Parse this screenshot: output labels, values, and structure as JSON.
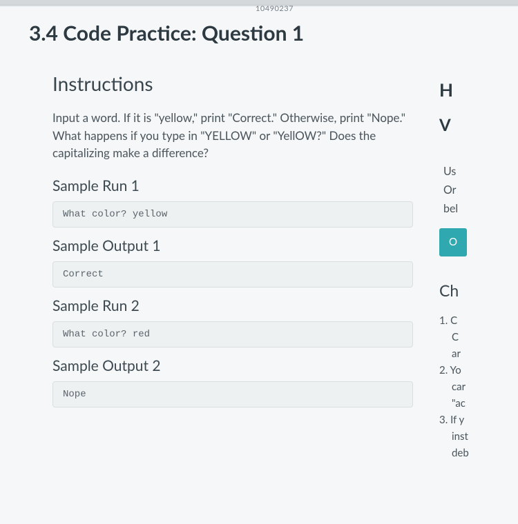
{
  "top_tab_fragment": "10490237",
  "title": "3.4 Code Practice: Question 1",
  "instructions": {
    "heading": "Instructions",
    "body": "Input a word. If it is \"yellow,\" print \"Correct.\" Otherwise, print \"Nope.\" What happens if you type in \"YELLOW\" or \"YellOW?\" Does the capitalizing make a difference?"
  },
  "samples": {
    "run1": {
      "heading": "Sample Run 1",
      "code": "What color? yellow"
    },
    "out1": {
      "heading": "Sample Output 1",
      "code": "Correct"
    },
    "run2": {
      "heading": "Sample Run 2",
      "code": "What color? red"
    },
    "out2": {
      "heading": "Sample Output 2",
      "code": "Nope"
    }
  },
  "sidebar": {
    "big_h": "H",
    "big_v": "V",
    "line_us": "Us",
    "line_or": "Or",
    "line_bel": "bel",
    "teal": "O",
    "ch": "Ch",
    "items": {
      "l1a": "1. C",
      "l1b": "C",
      "l1c": "ar",
      "l2a": "2. Yo",
      "l2b": "car",
      "l2c": "\"ac",
      "l3a": "3. If y",
      "l3b": "inst",
      "l3c": "deb"
    }
  }
}
